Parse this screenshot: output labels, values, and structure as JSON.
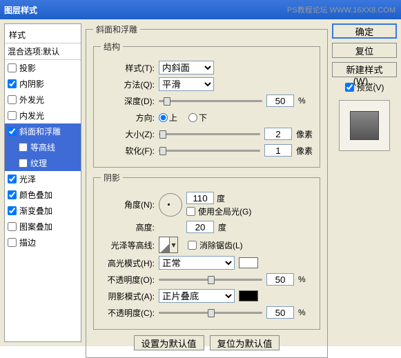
{
  "watermark": "PS教程论坛  WWW.16XX8.COM",
  "window_title": "图层样式",
  "styles": {
    "header": "样式",
    "blend_default": "混合选项:默认",
    "items": [
      {
        "label": "投影",
        "checked": false
      },
      {
        "label": "内阴影",
        "checked": true
      },
      {
        "label": "外发光",
        "checked": false
      },
      {
        "label": "内发光",
        "checked": false
      },
      {
        "label": "斜面和浮雕",
        "checked": true,
        "selected": true
      },
      {
        "label": "光泽",
        "checked": true
      },
      {
        "label": "颜色叠加",
        "checked": true
      },
      {
        "label": "渐变叠加",
        "checked": true
      },
      {
        "label": "图案叠加",
        "checked": false
      },
      {
        "label": "描边",
        "checked": false
      }
    ],
    "sub": [
      {
        "label": "等高线",
        "checked": false
      },
      {
        "label": "纹理",
        "checked": false
      }
    ]
  },
  "main": {
    "group_title": "斜面和浮雕",
    "structure_title": "结构",
    "style_label": "样式(T):",
    "style_value": "内斜面",
    "technique_label": "方法(Q):",
    "technique_value": "平滑",
    "depth_label": "深度(D):",
    "depth_value": "50",
    "percent": "%",
    "direction_label": "方向:",
    "dir_up": "上",
    "dir_down": "下",
    "size_label": "大小(Z):",
    "size_value": "2",
    "px": "像素",
    "soften_label": "软化(F):",
    "soften_value": "1",
    "shading_title": "阴影",
    "angle_label": "角度(N):",
    "angle_value": "110",
    "degree": "度",
    "use_global": "使用全局光(G)",
    "altitude_label": "高度:",
    "altitude_value": "20",
    "gloss_contour_label": "光泽等高线:",
    "antialias": "消除锯齿(L)",
    "highlight_mode_label": "高光模式(H):",
    "highlight_mode_value": "正常",
    "opacity1_label": "不透明度(O):",
    "opacity1_value": "50",
    "shadow_mode_label": "阴影模式(A):",
    "shadow_mode_value": "正片叠底",
    "opacity2_label": "不透明度(C):",
    "opacity2_value": "50",
    "make_default": "设置为默认值",
    "reset_default": "复位为默认值"
  },
  "actions": {
    "ok": "确定",
    "cancel": "复位",
    "new_style": "新建样式(W)...",
    "preview": "预览(V)"
  }
}
